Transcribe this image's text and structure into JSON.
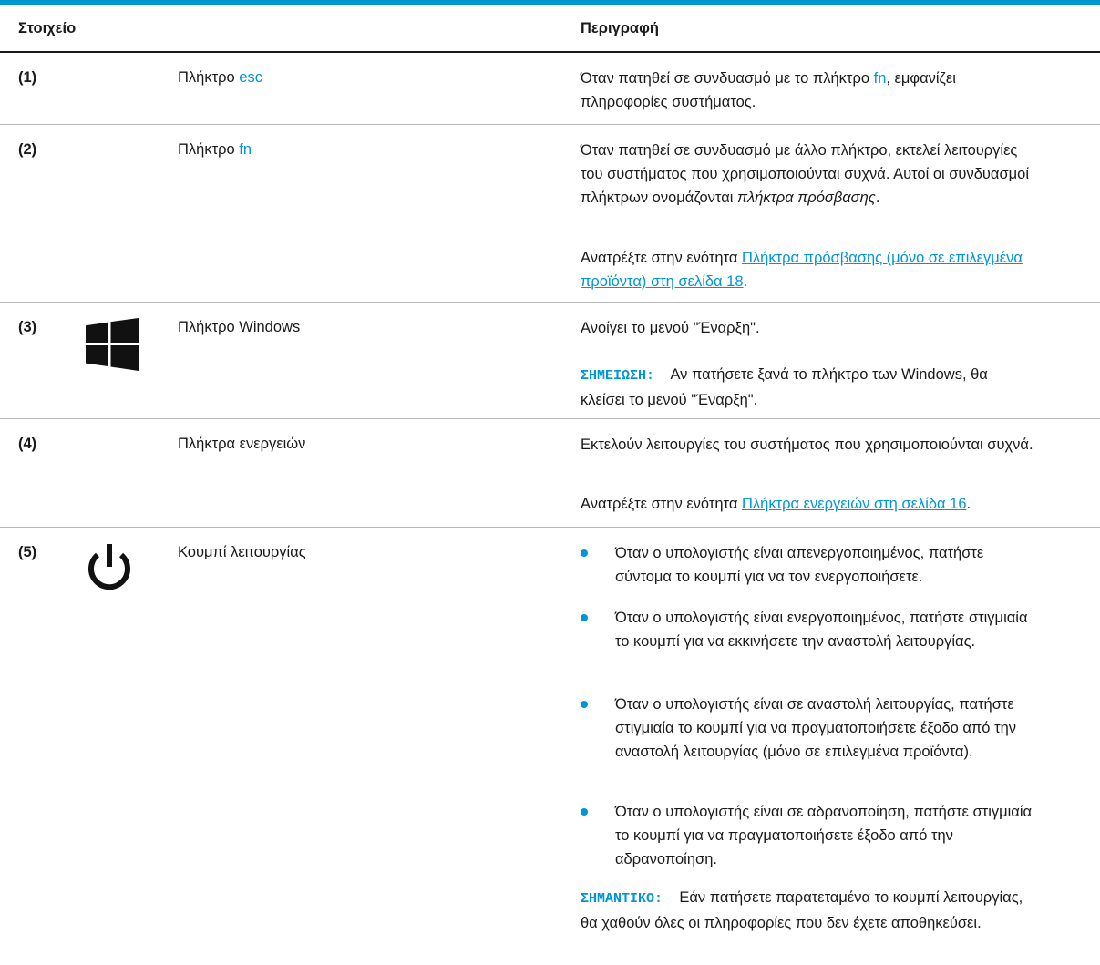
{
  "colors": {
    "accent": "#0096d6",
    "text": "#1a1a1a",
    "rule": "#b8b8b8"
  },
  "header": {
    "col_item": "Στοιχείο",
    "col_desc": "Περιγραφή"
  },
  "rows": [
    {
      "num": "(1)",
      "name_prefix": "Πλήκτρο",
      "name_key": "esc",
      "desc_a": "Όταν πατηθεί σε συνδυασμό με το πλήκτρο",
      "desc_key": "fn",
      "desc_b": ", εμφανίζει πληροφορίες συστήματος."
    },
    {
      "num": "(2)",
      "name_prefix": "Πλήκτρο",
      "name_key": "fn",
      "desc_a": "Όταν πατηθεί σε συνδυασμό με άλλο πλήκτρο, εκτελεί λειτουργίες του συστήματος που χρησιμοποιούνται συχνά. Αυτοί οι συνδυασμοί πλήκτρων ονομάζονται",
      "desc_em": "πλήκτρα πρόσβασης",
      "desc_b": ".",
      "ref_prefix": "Ανατρέξτε στην ενότητα",
      "ref_link": "Πλήκτρα πρόσβασης (μόνο σε επιλεγμένα προϊόντα) στη σελίδα 18",
      "ref_suffix": "."
    },
    {
      "num": "(3)",
      "icon": "windows-logo-icon",
      "name": "Πλήκτρο Windows",
      "desc": "Ανοίγει το μενού \"Έναρξη\".",
      "note_label": "ΣΗΜΕΙΩΣΗ:",
      "note_text": "Αν πατήσετε ξανά το πλήκτρο των Windows, θα κλείσει το μενού \"Έναρξη\"."
    },
    {
      "num": "(4)",
      "name": "Πλήκτρα ενεργειών",
      "desc": "Εκτελούν λειτουργίες του συστήματος που χρησιμοποιούνται συχνά.",
      "ref_prefix": "Ανατρέξτε στην ενότητα",
      "ref_link": "Πλήκτρα ενεργειών στη σελίδα 16",
      "ref_suffix": "."
    },
    {
      "num": "(5)",
      "icon": "power-icon",
      "name": "Κουμπί λειτουργίας",
      "bullets": [
        "Όταν ο υπολογιστής είναι απενεργοποιημένος, πατήστε σύντομα το κουμπί για να τον ενεργοποιήσετε.",
        "Όταν ο υπολογιστής είναι ενεργοποιημένος, πατήστε στιγμιαία το κουμπί για να εκκινήσετε την αναστολή λειτουργίας.",
        "Όταν ο υπολογιστής είναι σε αναστολή λειτουργίας, πατήστε στιγμιαία το κουμπί για να πραγματοποιήσετε έξοδο από την αναστολή λειτουργίας (μόνο σε επιλεγμένα προϊόντα).",
        "Όταν ο υπολογιστής είναι σε αδρανοποίηση, πατήστε στιγμιαία το κουμπί για να πραγματοποιήσετε έξοδο από την αδρανοποίηση."
      ],
      "note_label": "ΣΗΜΑΝΤΙΚΟ:",
      "note_text": "Εάν πατήσετε παρατεταμένα το κουμπί λειτουργίας, θα χαθούν όλες οι πληροφορίες που δεν έχετε αποθηκεύσει."
    }
  ]
}
